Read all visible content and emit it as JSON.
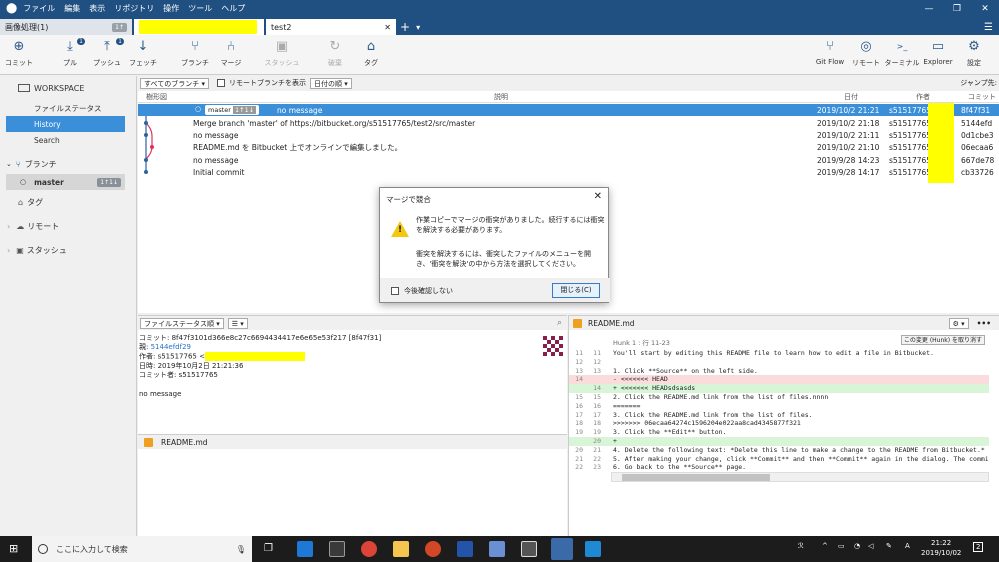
{
  "titlebar": {
    "menu": [
      "ファイル",
      "編集",
      "表示",
      "リポジトリ",
      "操作",
      "ツール",
      "ヘルプ"
    ],
    "controls": [
      "—",
      "❐",
      "✕"
    ]
  },
  "tabs": [
    {
      "label": "画像処理(1)",
      "badge": "1↑"
    },
    {
      "label": "",
      "badge": ""
    },
    {
      "label": "test2",
      "close": "✕"
    }
  ],
  "tabbar": {
    "add": "+",
    "dropdown": "▾",
    "menu": "☰"
  },
  "toolbar": {
    "left": [
      {
        "label": "コミット",
        "icon": "⊕"
      },
      {
        "label": "プル",
        "icon": "⤓",
        "badge": "1"
      },
      {
        "label": "プッシュ",
        "icon": "⤒",
        "badge": "1"
      },
      {
        "label": "フェッチ",
        "icon": "↓"
      },
      {
        "label": "ブランチ",
        "icon": "⑂"
      },
      {
        "label": "マージ",
        "icon": "⑃"
      },
      {
        "label": "スタッシュ",
        "icon": "▣"
      },
      {
        "label": "破棄",
        "icon": "↻"
      },
      {
        "label": "タグ",
        "icon": "⌂"
      }
    ],
    "right": [
      {
        "label": "Git Flow",
        "icon": "⑂"
      },
      {
        "label": "リモート",
        "icon": "◎"
      },
      {
        "label": "ターミナル",
        "icon": ">_"
      },
      {
        "label": "Explorer",
        "icon": "▭"
      },
      {
        "label": "設定",
        "icon": "⚙"
      }
    ]
  },
  "sidebar": {
    "workspace": "WORKSPACE",
    "items": [
      "ファイルステータス",
      "History",
      "Search"
    ],
    "branches_label": "ブランチ",
    "branch_name": "master",
    "branch_badge": "1↑1↓",
    "tags": "タグ",
    "remote": "リモート",
    "stash": "スタッシュ"
  },
  "filterbar": {
    "branches": "すべてのブランチ ▾",
    "remote_label": "リモートブランチを表示",
    "order": "日付の順 ▾",
    "jump": "ジャンプ先:"
  },
  "columns": {
    "graph": "樹形図",
    "desc": "説明",
    "date": "日付",
    "author": "作者",
    "commit": "コミット"
  },
  "commits": [
    {
      "msg": "no message",
      "date": "2019/10/2 21:21",
      "author": "s51517765",
      "hash": "8f47f31",
      "branch": "master",
      "ahead": "1↑1↓"
    },
    {
      "msg": "Merge branch 'master' of https://bitbucket.org/s51517765/test2/src/master",
      "date": "2019/10/2 21:18",
      "author": "s51517765",
      "hash": "5144efd"
    },
    {
      "msg": "no message",
      "date": "2019/10/2 21:11",
      "author": "s51517765",
      "hash": "0d1cbe3"
    },
    {
      "msg": "README.md を Bitbucket 上でオンラインで編集しました。",
      "date": "2019/10/2 21:10",
      "author": "s51517765",
      "hash": "06ecaa6"
    },
    {
      "msg": "no message",
      "date": "2019/9/28 14:23",
      "author": "s51517765",
      "hash": "667de78"
    },
    {
      "msg": "Initial commit",
      "date": "2019/9/28 14:17",
      "author": "s51517765",
      "hash": "cb33726"
    }
  ],
  "dialog": {
    "title": "マージで競合",
    "close": "✕",
    "p1": "作業コピーでマージの衝突がありました。続行するには衝突を解決する必要があります。",
    "p2": "衝突を解決するには、衝突したファイルのメニューを開き、'衝突を解決'の中から方法を選択してください。",
    "checkbox": "今後確認しない",
    "button": "閉じる(C)",
    "warn": "!"
  },
  "details": {
    "sort": "ファイルステータス順 ▾",
    "view": "☰ ▾",
    "commit": "コミット: 8f47f3101d366e8c27c6694434417e6e65e53f217 [8f47f31]",
    "parent_label": "親:",
    "parent": "5144efdf29",
    "author": "作者: s51517765 <",
    "date": "日時: 2019年10月2日 21:21:36",
    "committer": "コミット者: s51517765",
    "message": "no message",
    "file": "README.md",
    "search_icon": "⌕"
  },
  "diffpane": {
    "file": "README.md",
    "hunk": "Hunk 1 : 行 11-23",
    "discard": "この変更 (Hunk) を取り消す",
    "more": "•••",
    "gear": "⚙ ▾",
    "lines": [
      {
        "o": "11",
        "n": "11",
        "t": "You'll start by editing this README file to learn how to edit a file in Bitbucket.",
        "k": ""
      },
      {
        "o": "12",
        "n": "12",
        "t": "",
        "k": ""
      },
      {
        "o": "13",
        "n": "13",
        "t": "1. Click **Source** on the left side.",
        "k": ""
      },
      {
        "o": "14",
        "n": "",
        "t": "- <<<<<<< HEAD",
        "k": "del"
      },
      {
        "o": "",
        "n": "14",
        "t": "+ <<<<<<< HEADsdsasds",
        "k": "add"
      },
      {
        "o": "15",
        "n": "15",
        "t": "2. Click the README.md link from the list of files.nnnn",
        "k": ""
      },
      {
        "o": "16",
        "n": "16",
        "t": "=======",
        "k": ""
      },
      {
        "o": "17",
        "n": "17",
        "t": "3. Click the README.md link from the list of files.",
        "k": ""
      },
      {
        "o": "18",
        "n": "18",
        "t": ">>>>>>> 06ecaa64274c1596204e022aa8cad4345877f321",
        "k": ""
      },
      {
        "o": "19",
        "n": "19",
        "t": "3. Click the **Edit** button.",
        "k": ""
      },
      {
        "o": "",
        "n": "20",
        "t": "+",
        "k": "add"
      },
      {
        "o": "20",
        "n": "21",
        "t": "4. Delete the following text: *Delete this line to make a change to the README from Bitbucket.*",
        "k": ""
      },
      {
        "o": "21",
        "n": "22",
        "t": "5. After making your change, click **Commit** and then **Commit** again in the dialog. The commit page will open",
        "k": ""
      },
      {
        "o": "22",
        "n": "23",
        "t": "6. Go back to the **Source** page.",
        "k": ""
      }
    ]
  },
  "taskbar": {
    "search": "ここに入力して検索",
    "time": "21:22",
    "date": "2019/10/02",
    "ime": "A",
    "notif": "2"
  },
  "colors": {
    "accent": "#205081",
    "select": "#3a8fd8"
  }
}
